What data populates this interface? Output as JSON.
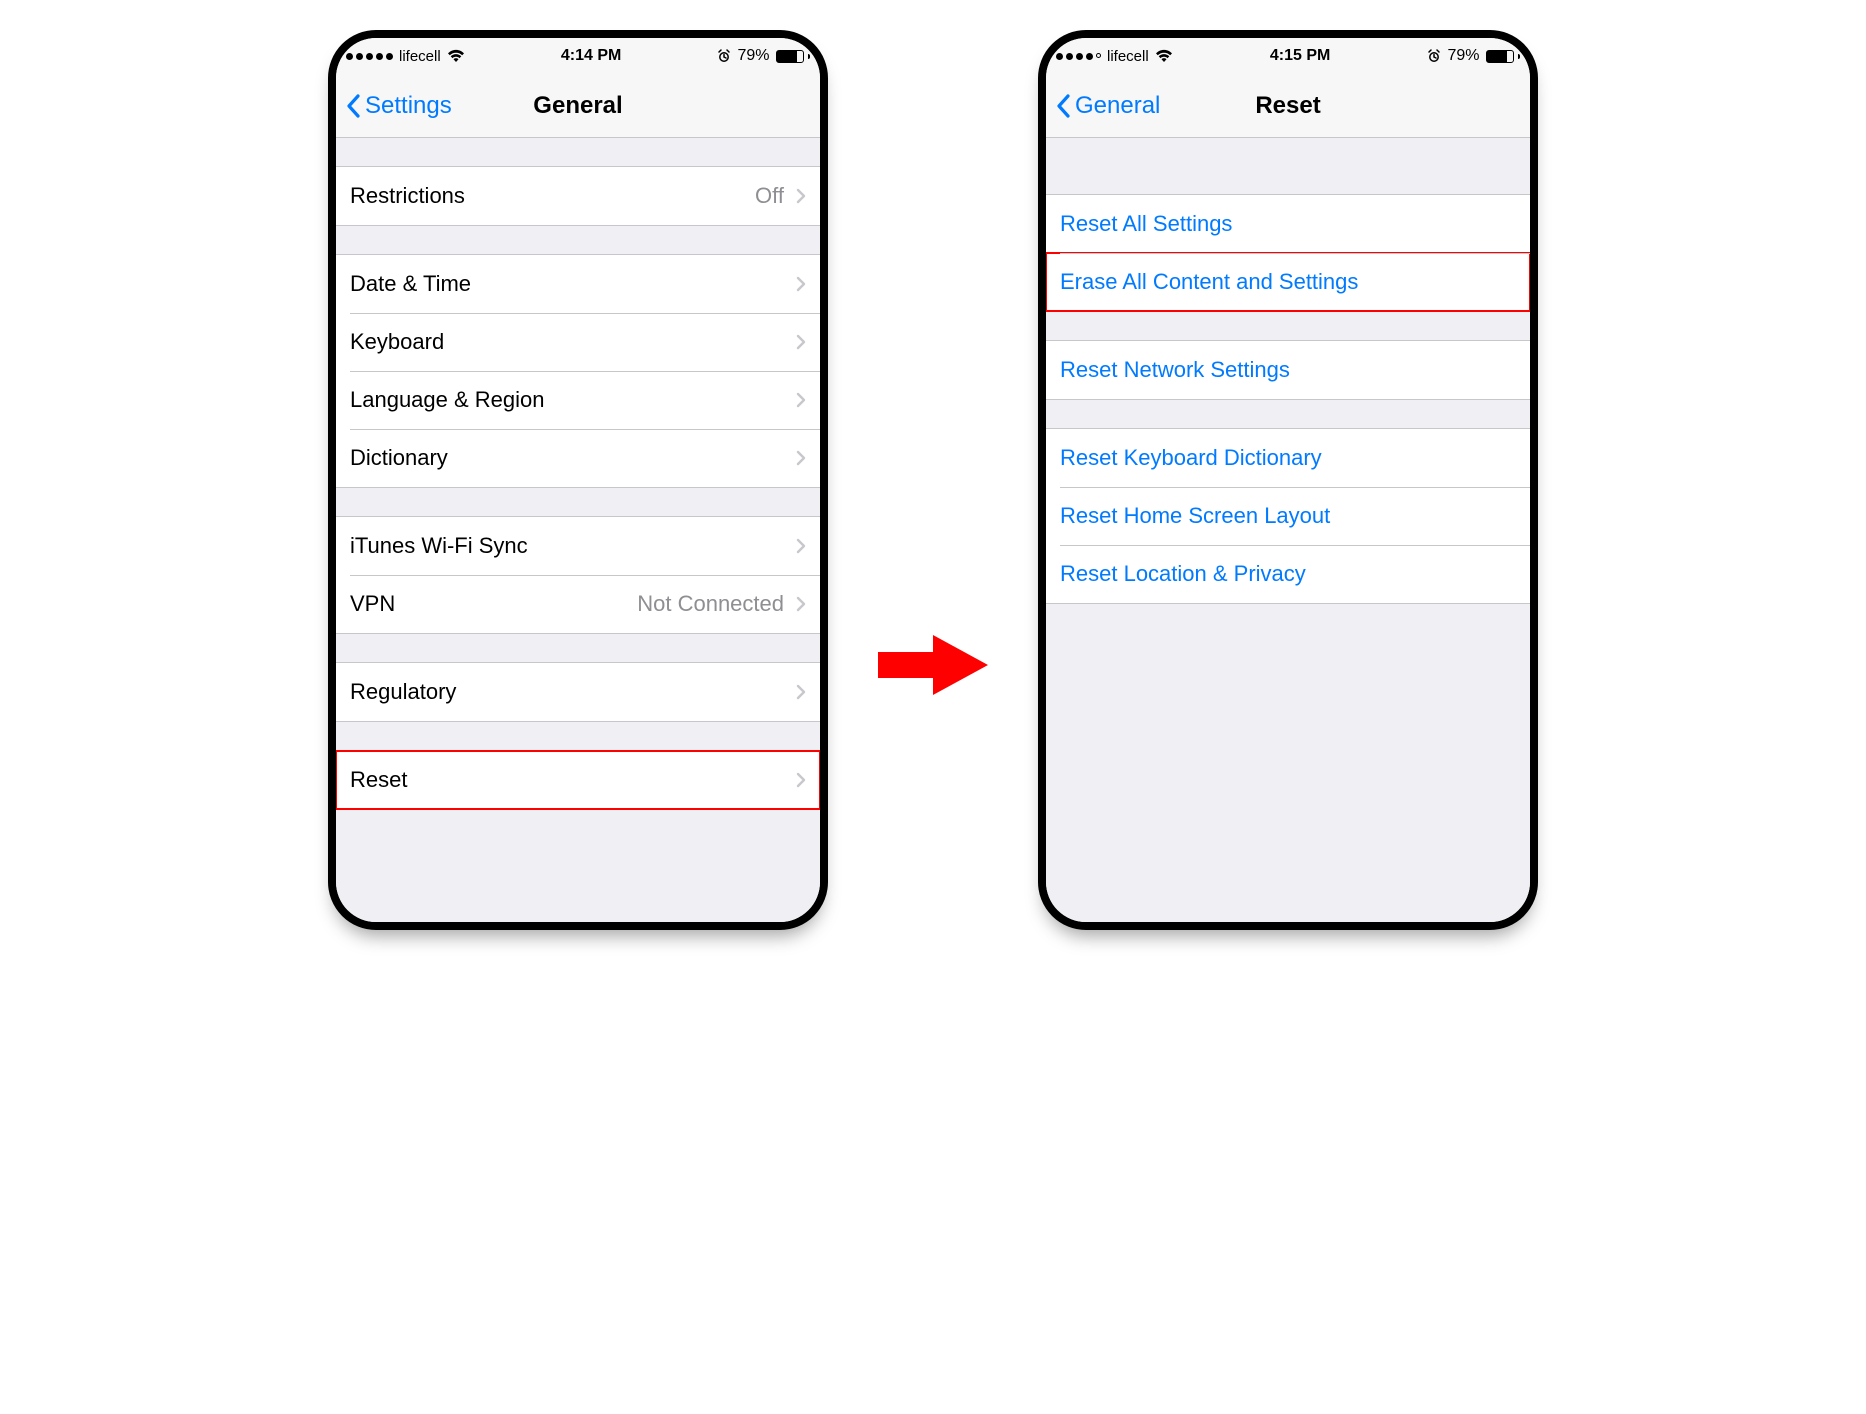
{
  "left": {
    "status": {
      "carrier": "lifecell",
      "time": "4:14 PM",
      "battery_pct": "79%",
      "battery_fill": 79,
      "dots_filled": 5
    },
    "nav": {
      "back": "Settings",
      "title": "General"
    },
    "group1": [
      {
        "label": "Restrictions",
        "value": "Off"
      }
    ],
    "group2": [
      {
        "label": "Date & Time"
      },
      {
        "label": "Keyboard"
      },
      {
        "label": "Language & Region"
      },
      {
        "label": "Dictionary"
      }
    ],
    "group3": [
      {
        "label": "iTunes Wi-Fi Sync"
      },
      {
        "label": "VPN",
        "value": "Not Connected"
      }
    ],
    "group4": [
      {
        "label": "Regulatory"
      }
    ],
    "group5": [
      {
        "label": "Reset",
        "highlight": true
      }
    ]
  },
  "right": {
    "status": {
      "carrier": "lifecell",
      "time": "4:15 PM",
      "battery_pct": "79%",
      "battery_fill": 79,
      "dots_filled": 4
    },
    "nav": {
      "back": "General",
      "title": "Reset"
    },
    "group1": [
      {
        "label": "Reset All Settings"
      },
      {
        "label": "Erase All Content and Settings",
        "highlight": true
      }
    ],
    "group2": [
      {
        "label": "Reset Network Settings"
      }
    ],
    "group3": [
      {
        "label": "Reset Keyboard Dictionary"
      },
      {
        "label": "Reset Home Screen Layout"
      },
      {
        "label": "Reset Location & Privacy"
      }
    ]
  }
}
